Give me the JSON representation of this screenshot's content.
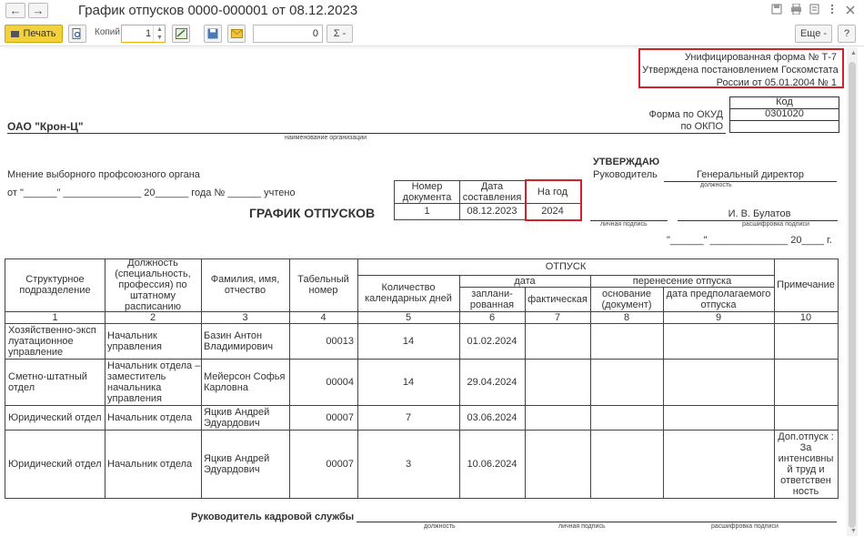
{
  "window": {
    "title": "График отпусков 0000-000001 от 08.12.2023",
    "back_glyph": "←",
    "forward_glyph": "→"
  },
  "toolbar": {
    "print_label": "Печать",
    "copies_label": "Копий:",
    "copies_value": "1",
    "number_value": "0",
    "sum_label": "Σ -",
    "more_label": "Еще -",
    "help_label": "?"
  },
  "form": {
    "unified_line1": "Унифицированная форма № Т-7",
    "unified_line2": "Утверждена постановлением Госкомстата",
    "unified_line3": "России от 05.01.2004 № 1",
    "code_header": "Код",
    "okud_label": "Форма по ОКУД",
    "okud_value": "0301020",
    "okpo_label": "по ОКПО",
    "org_name": "ОАО \"Крон-Ц\"",
    "org_caption": "наименование организации",
    "union_opinion": "Мнение выборного профсоюзного органа",
    "union_line": "от \"______\" ______________ 20______ года № ______ учтено",
    "approve_title": "УТВЕРЖДАЮ",
    "head_label": "Руководитель",
    "head_position": "Генеральный директор",
    "position_caption": "должность",
    "head_name": "И. В. Булатов",
    "signature_caption": "личная подпись",
    "decode_caption": "расшифровка подписи",
    "date_line": "\"______\" ______________ 20____ г.",
    "doc_title": "ГРАФИК ОТПУСКОВ",
    "docnum_header": "Номер документа",
    "docdate_header": "Дата составления",
    "year_header": "На год",
    "docnum_value": "1",
    "docdate_value": "08.12.2023",
    "year_value": "2024"
  },
  "table": {
    "headers": {
      "dept": "Структурное подразделение",
      "position": "Должность (специальность, профессия) по штатному расписанию",
      "name": "Фамилия, имя, отчество",
      "tabnum": "Табельный номер",
      "leave": "ОТПУСК",
      "days": "Количество календарных дней",
      "date": "дата",
      "planned": "заплани-рованная",
      "actual": "фактическая",
      "transfer": "перенесение отпуска",
      "basis": "основание (документ)",
      "expected": "дата предполагаемого отпуска",
      "note": "Примечание"
    },
    "col_numbers": [
      "1",
      "2",
      "3",
      "4",
      "5",
      "6",
      "7",
      "8",
      "9",
      "10"
    ],
    "rows": [
      {
        "dept": "Хозяйственно-эксп луатационное управление",
        "position": "Начальник управления",
        "name": "Базин Антон Владимирович",
        "tabnum": "00013",
        "days": "14",
        "planned": "01.02.2024",
        "note": ""
      },
      {
        "dept": "Сметно-штатный отдел",
        "position": "Начальник отдела – заместитель начальника управления",
        "name": "Мейерсон Софья Карловна",
        "tabnum": "00004",
        "days": "14",
        "planned": "29.04.2024",
        "note": ""
      },
      {
        "dept": "Юридический отдел",
        "position": "Начальник отдела",
        "name": "Яцкив Андрей Эдуардович",
        "tabnum": "00007",
        "days": "7",
        "planned": "03.06.2024",
        "note": ""
      },
      {
        "dept": "Юридический отдел",
        "position": "Начальник отдела",
        "name": "Яцкив Андрей Эдуардович",
        "tabnum": "00007",
        "days": "3",
        "planned": "10.06.2024",
        "note": "Доп.отпуск : За интенсивны й труд и ответствен ность"
      }
    ]
  },
  "footer": {
    "hr_head": "Руководитель кадровой службы",
    "position_caption": "должность",
    "signature_caption": "личная подпись",
    "decode_caption": "расшифровка подписи"
  },
  "colors": {
    "accent_yellow": "#f2d13c",
    "highlight_red": "#d4202a"
  }
}
